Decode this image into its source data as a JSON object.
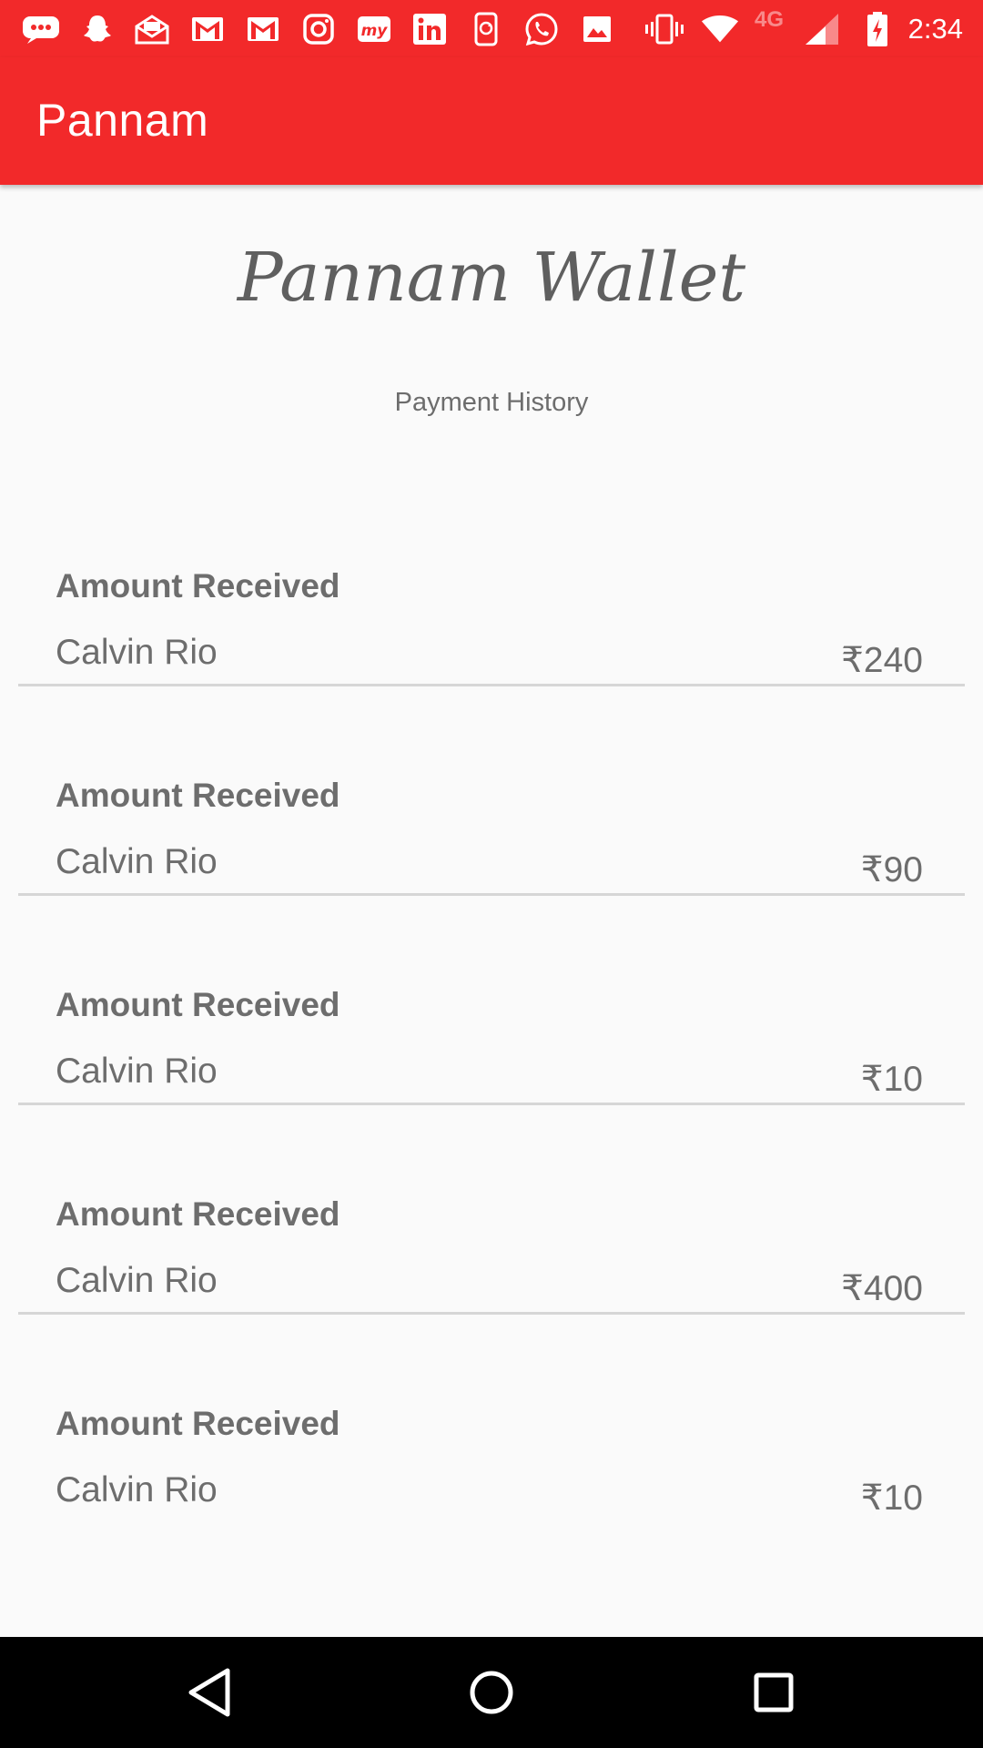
{
  "status_bar": {
    "icons": [
      "messages-icon",
      "snapchat-icon",
      "email-open-icon",
      "gmail-icon",
      "gmail-icon",
      "instagram-icon",
      "mytrip-icon",
      "linkedin-icon",
      "phone-sync-icon",
      "whatsapp-icon",
      "image-icon",
      "vibrate-icon",
      "wifi-icon",
      "signal-icon",
      "battery-charging-icon"
    ],
    "network": "4G",
    "time": "2:34"
  },
  "app_bar": {
    "title": "Pannam"
  },
  "header": {
    "wallet_title": "Pannam Wallet",
    "section_title": "Payment History"
  },
  "history": [
    {
      "heading": "Amount Received",
      "name": "Calvin Rio",
      "amount": "₹240"
    },
    {
      "heading": "Amount Received",
      "name": "Calvin Rio",
      "amount": "₹90"
    },
    {
      "heading": "Amount Received",
      "name": "Calvin Rio",
      "amount": "₹10"
    },
    {
      "heading": "Amount Received",
      "name": "Calvin Rio",
      "amount": "₹400"
    },
    {
      "heading": "Amount Received",
      "name": "Calvin Rio",
      "amount": "₹10"
    }
  ],
  "nav_bar": {
    "icons": [
      "back-icon",
      "home-icon",
      "recents-icon"
    ]
  },
  "colors": {
    "brand": "#f2292a",
    "text_gray": "#6d6d6d",
    "background": "#fafafa"
  }
}
